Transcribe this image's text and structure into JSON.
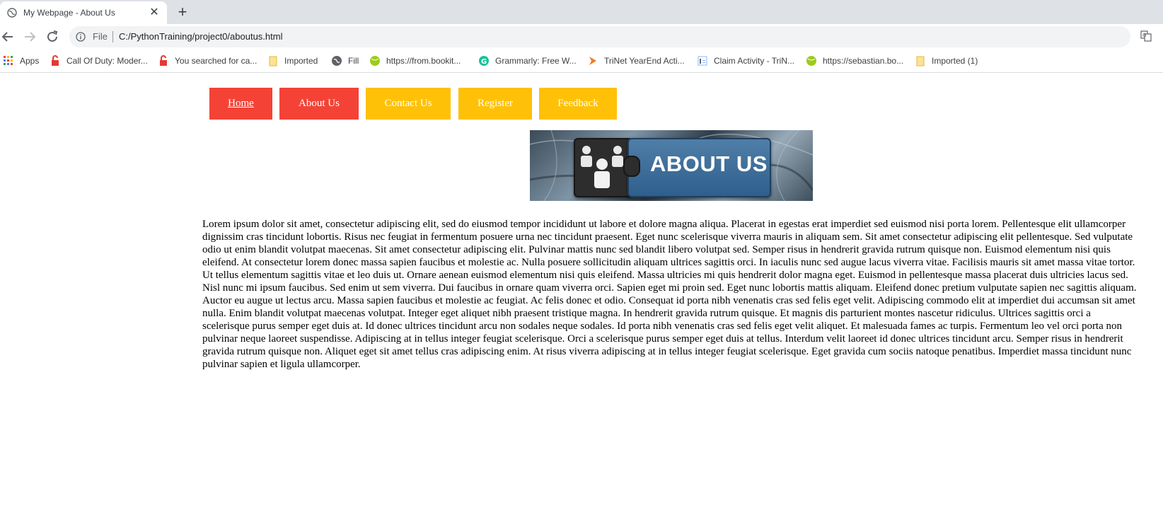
{
  "browser": {
    "tab_title": "My Webpage - About Us",
    "tab_close": "✕",
    "new_tab": "+",
    "scheme": "File",
    "url": "C:/PythonTraining/project0/aboutus.html"
  },
  "bookmarks": [
    {
      "label": "Apps",
      "icon": "apps-grid-icon"
    },
    {
      "label": "Call Of Duty: Moder...",
      "icon": "lock-icon"
    },
    {
      "label": "You searched for ca...",
      "icon": "lock-icon"
    },
    {
      "label": "Imported",
      "icon": "folder-icon"
    },
    {
      "label": "Fill",
      "icon": "globe-icon"
    },
    {
      "label": "https://from.bookit...",
      "icon": "green-ball-icon"
    },
    {
      "label": "Grammarly: Free W...",
      "icon": "grammarly-icon"
    },
    {
      "label": "TriNet YearEnd Acti...",
      "icon": "trinet-icon"
    },
    {
      "label": "Claim Activity - TriN...",
      "icon": "document-icon"
    },
    {
      "label": "https://sebastian.bo...",
      "icon": "green-ball-icon"
    },
    {
      "label": "Imported (1)",
      "icon": "folder-icon"
    }
  ],
  "nav": {
    "home": "Home",
    "about": "About Us",
    "contact": "Contact Us",
    "register": "Register",
    "feedback": "Feedback"
  },
  "banner": {
    "text": "ABOUT US"
  },
  "content": {
    "paragraph": "Lorem ipsum dolor sit amet, consectetur adipiscing elit, sed do eiusmod tempor incididunt ut labore et dolore magna aliqua. Placerat in egestas erat imperdiet sed euismod nisi porta lorem. Pellentesque elit ullamcorper dignissim cras tincidunt lobortis. Risus nec feugiat in fermentum posuere urna nec tincidunt praesent. Eget nunc scelerisque viverra mauris in aliquam sem. Sit amet consectetur adipiscing elit pellentesque. Sed vulputate odio ut enim blandit volutpat maecenas. Sit amet consectetur adipiscing elit. Pulvinar mattis nunc sed blandit libero volutpat sed. Semper risus in hendrerit gravida rutrum quisque non. Euismod elementum nisi quis eleifend. At consectetur lorem donec massa sapien faucibus et molestie ac. Nulla posuere sollicitudin aliquam ultrices sagittis orci. In iaculis nunc sed augue lacus viverra vitae. Facilisis mauris sit amet massa vitae tortor. Ut tellus elementum sagittis vitae et leo duis ut. Ornare aenean euismod elementum nisi quis eleifend. Massa ultricies mi quis hendrerit dolor magna eget. Euismod in pellentesque massa placerat duis ultricies lacus sed. Nisl nunc mi ipsum faucibus. Sed enim ut sem viverra. Dui faucibus in ornare quam viverra orci. Sapien eget mi proin sed. Eget nunc lobortis mattis aliquam. Eleifend donec pretium vulputate sapien nec sagittis aliquam. Auctor eu augue ut lectus arcu. Massa sapien faucibus et molestie ac feugiat. Ac felis donec et odio. Consequat id porta nibh venenatis cras sed felis eget velit. Adipiscing commodo elit at imperdiet dui accumsan sit amet nulla. Enim blandit volutpat maecenas volutpat. Integer eget aliquet nibh praesent tristique magna. In hendrerit gravida rutrum quisque. Et magnis dis parturient montes nascetur ridiculus. Ultrices sagittis orci a scelerisque purus semper eget duis at. Id donec ultrices tincidunt arcu non sodales neque sodales. Id porta nibh venenatis cras sed felis eget velit aliquet. Et malesuada fames ac turpis. Fermentum leo vel orci porta non pulvinar neque laoreet suspendisse. Adipiscing at in tellus integer feugiat scelerisque. Orci a scelerisque purus semper eget duis at tellus. Interdum velit laoreet id donec ultrices tincidunt arcu. Semper risus in hendrerit gravida rutrum quisque non. Aliquet eget sit amet tellus cras adipiscing enim. At risus viverra adipiscing at in tellus integer feugiat scelerisque. Eget gravida cum sociis natoque penatibus. Imperdiet massa tincidunt nunc pulvinar sapien et ligula ullamcorper."
  },
  "colors": {
    "nav_red": "#f44336",
    "nav_amber": "#ffc107"
  }
}
